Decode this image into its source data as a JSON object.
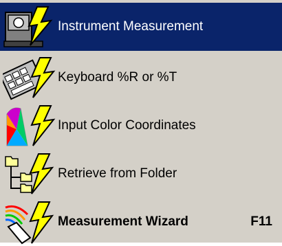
{
  "menu": {
    "items": [
      {
        "label": "Instrument Measurement",
        "shortcut": "",
        "selected": true,
        "icon": "instrument-icon"
      },
      {
        "label": "Keyboard %R or %T",
        "shortcut": "",
        "selected": false,
        "icon": "keyboard-icon"
      },
      {
        "label": "Input Color Coordinates",
        "shortcut": "",
        "selected": false,
        "icon": "color-coordinates-icon"
      },
      {
        "label": "Retrieve from Folder",
        "shortcut": "",
        "selected": false,
        "icon": "folder-tree-icon"
      },
      {
        "label": "Measurement Wizard",
        "shortcut": "F11",
        "selected": false,
        "bold": true,
        "icon": "wizard-icon"
      }
    ]
  },
  "colors": {
    "menu_background": "#d4d0c8",
    "selection": "#0a246a",
    "lightning": "#ffff00"
  }
}
